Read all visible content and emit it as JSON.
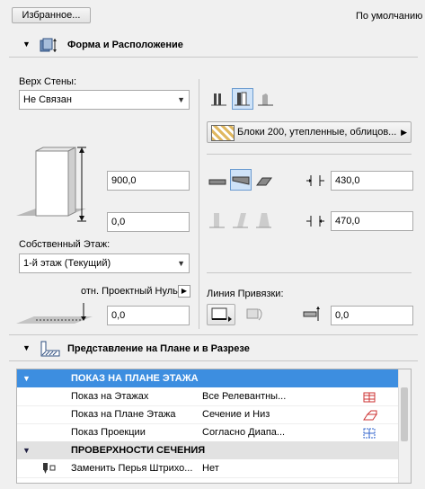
{
  "top": {
    "favorites_label": "Избранное...",
    "default_label": "По умолчанию"
  },
  "section1": {
    "title": "Форма и Расположение"
  },
  "wall": {
    "top_label": "Верх Стены:",
    "top_value": "Не Связан",
    "height_value": "900,0",
    "bottom_offset_value": "0,0",
    "home_story_label": "Собственный Этаж:",
    "home_story_value": "1-й этаж (Текущий)",
    "ref_level_label": "отн. Проектный Нуль",
    "ref_level_value": "0,0"
  },
  "composite": {
    "label": "Блоки 200, утепленные, облицов..."
  },
  "thickness": {
    "value1": "430,0",
    "value2": "470,0"
  },
  "refline": {
    "label": "Линия Привязки:",
    "offset_value": "0,0"
  },
  "section2": {
    "title": "Представление на Плане и в Разрезе"
  },
  "table": {
    "rows": [
      {
        "kind": "group",
        "label": "ПОКАЗ НА ПЛАНЕ ЭТАЖА"
      },
      {
        "kind": "item",
        "label": "Показ на Этажах",
        "value": "Все Релевантны..."
      },
      {
        "kind": "item",
        "label": "Показ на Плане Этажа",
        "value": "Сечение и Низ"
      },
      {
        "kind": "item",
        "label": "Показ Проекции",
        "value": "Согласно Диапа..."
      },
      {
        "kind": "group",
        "label": "ПРОВЕРХНОСТИ СЕЧЕНИЯ"
      },
      {
        "kind": "item",
        "label": "Заменить Перья Штрихо...",
        "value": "Нет"
      }
    ]
  },
  "colors": {
    "accent": "#3d8ee0",
    "selected_bg": "#cfe3f8"
  }
}
